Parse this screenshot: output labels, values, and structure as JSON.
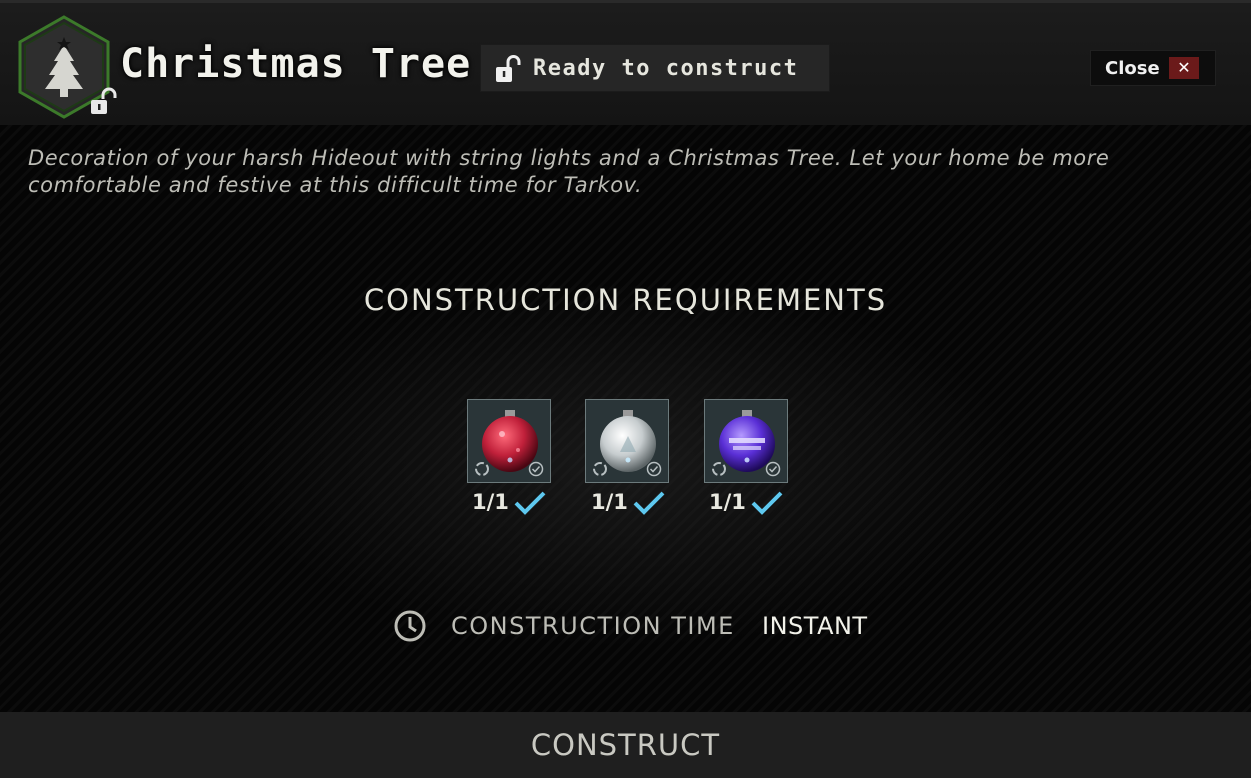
{
  "header": {
    "title": "Christmas Tree",
    "status": "Ready to construct",
    "close_label": "Close",
    "close_x": "✕",
    "icon": "christmas-tree-icon"
  },
  "description": "Decoration of your harsh Hideout with string lights and a Christmas Tree. Let your home be more comfortable and festive at this difficult time for Tarkov.",
  "requirements": {
    "title": "CONSTRUCTION REQUIREMENTS",
    "items": [
      {
        "icon": "red-ornament-icon",
        "count": "1/1",
        "color": "#c0203a"
      },
      {
        "icon": "silver-ornament-icon",
        "count": "1/1",
        "color": "#dfe4e6"
      },
      {
        "icon": "purple-ornament-icon",
        "count": "1/1",
        "color": "#5a2fd6"
      }
    ]
  },
  "construction_time": {
    "label": "CONSTRUCTION TIME",
    "value": "INSTANT"
  },
  "construct_button": "CONSTRUCT",
  "colors": {
    "accent_green": "#3c7a2a",
    "check_blue": "#5ec8ef",
    "close_red": "#6b1a1a"
  }
}
